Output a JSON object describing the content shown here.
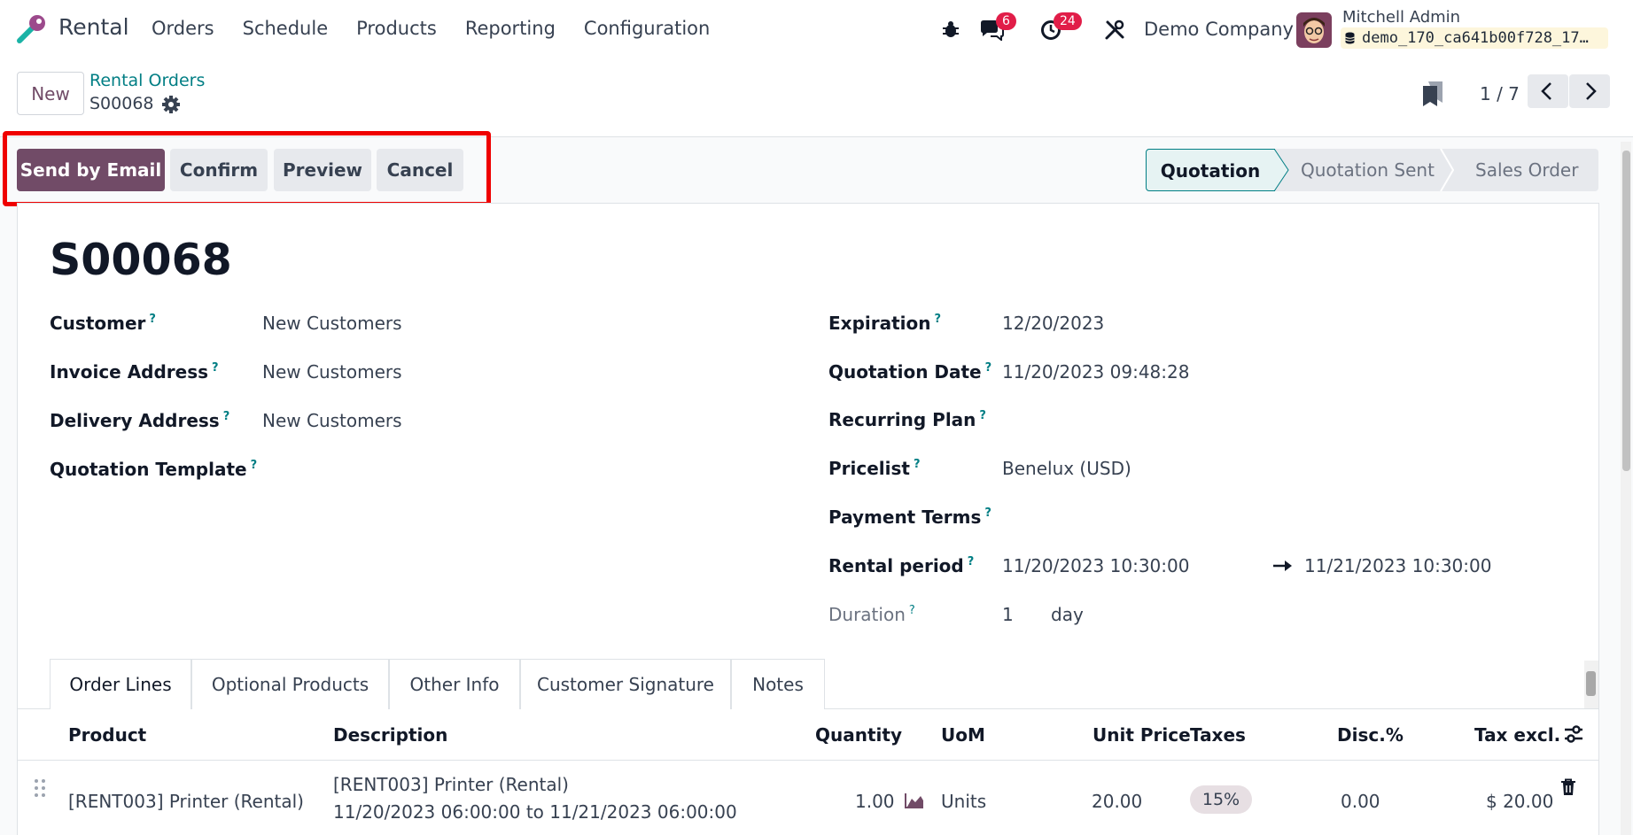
{
  "nav": {
    "app_name": "Rental",
    "menu": [
      "Orders",
      "Schedule",
      "Products",
      "Reporting",
      "Configuration"
    ],
    "messages_count": "6",
    "activities_count": "24",
    "company": "Demo Company",
    "user_name": "Mitchell Admin",
    "database": "demo_170_ca641b00f728_17…"
  },
  "control": {
    "new_label": "New",
    "breadcrumb_parent": "Rental Orders",
    "breadcrumb_current": "S00068",
    "pager": "1 / 7"
  },
  "actions": {
    "send_email": "Send by Email",
    "confirm": "Confirm",
    "preview": "Preview",
    "cancel": "Cancel"
  },
  "status": {
    "stages": [
      "Quotation",
      "Quotation Sent",
      "Sales Order"
    ],
    "active": "Quotation"
  },
  "record": {
    "name": "S00068",
    "left_fields": [
      {
        "label": "Customer",
        "value": "New Customers"
      },
      {
        "label": "Invoice Address",
        "value": "New Customers"
      },
      {
        "label": "Delivery Address",
        "value": "New Customers"
      },
      {
        "label": "Quotation Template",
        "value": ""
      }
    ],
    "right_fields": [
      {
        "label": "Expiration",
        "value": "12/20/2023"
      },
      {
        "label": "Quotation Date",
        "value": "11/20/2023 09:48:28"
      },
      {
        "label": "Recurring Plan",
        "value": ""
      },
      {
        "label": "Pricelist",
        "value": "Benelux (USD)"
      },
      {
        "label": "Payment Terms",
        "value": ""
      },
      {
        "label": "Rental period",
        "value": "11/20/2023 10:30:00",
        "value_end": "11/21/2023 10:30:00"
      },
      {
        "label": "Duration",
        "value": "1",
        "unit": "day"
      }
    ],
    "help_mark": "?"
  },
  "tabs": [
    "Order Lines",
    "Optional Products",
    "Other Info",
    "Customer Signature",
    "Notes"
  ],
  "table": {
    "headers": [
      "Product",
      "Description",
      "Quantity",
      "UoM",
      "Unit Price",
      "Taxes",
      "Disc.%",
      "Tax excl."
    ],
    "rows": [
      {
        "product": "[RENT003] Printer (Rental)",
        "description_line1": "[RENT003] Printer (Rental)",
        "description_line2": "11/20/2023 06:00:00 to 11/21/2023 06:00:00",
        "quantity": "1.00",
        "uom": "Units",
        "unit_price": "20.00",
        "taxes": "15%",
        "discount": "0.00",
        "subtotal": "$ 20.00"
      }
    ]
  },
  "colors": {
    "brand": "#714b67",
    "link": "#017e84",
    "highlight": "#ef0000",
    "badge": "#e11d48"
  }
}
